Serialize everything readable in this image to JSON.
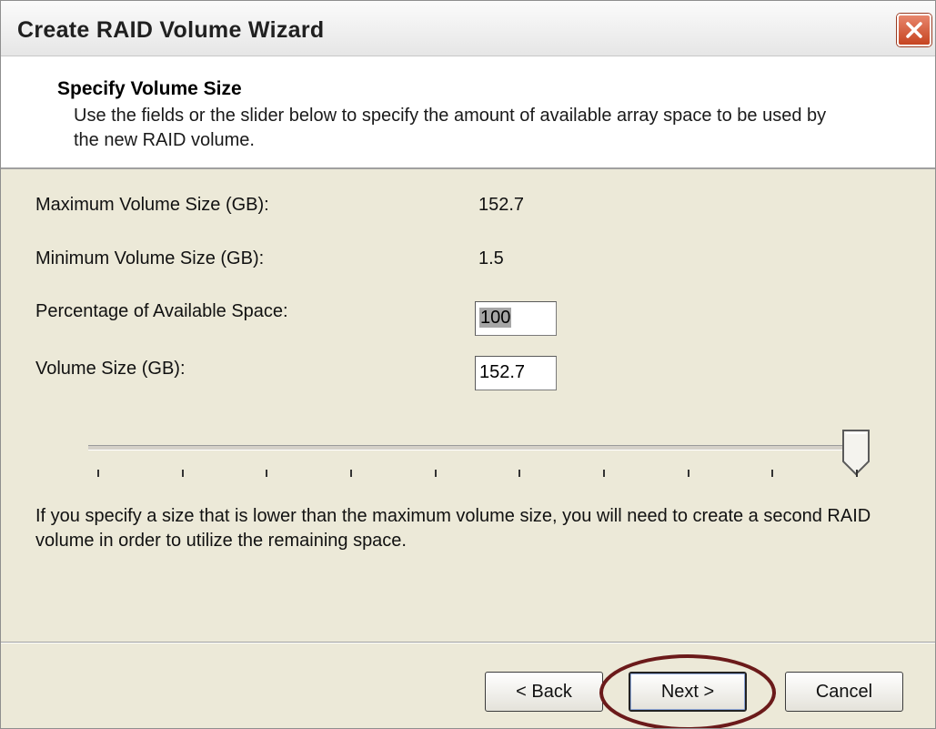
{
  "window": {
    "title": "Create RAID Volume Wizard",
    "close_icon": "close-x-icon"
  },
  "header": {
    "title": "Specify Volume Size",
    "description": "Use the fields or the slider below to specify the amount of available array space to be used by the new RAID volume."
  },
  "fields": {
    "max_label": "Maximum Volume Size (GB):",
    "max_value": "152.7",
    "min_label": "Minimum Volume Size (GB):",
    "min_value": "1.5",
    "percentage_label": "Percentage of Available Space:",
    "percentage_value": "100",
    "volume_size_label": "Volume Size (GB):",
    "volume_size_value": "152.7"
  },
  "slider": {
    "value_percent": 100,
    "tick_count": 10
  },
  "info": {
    "text": "If you specify a size that is lower than the maximum volume size, you will need to create a second RAID volume in order to utilize the remaining space."
  },
  "buttons": {
    "back": "< Back",
    "next": "Next >",
    "cancel": "Cancel"
  },
  "colors": {
    "close_button": "#c64421",
    "dialog_background": "#ece9d8",
    "highlight_ellipse": "#6b1a1a"
  }
}
